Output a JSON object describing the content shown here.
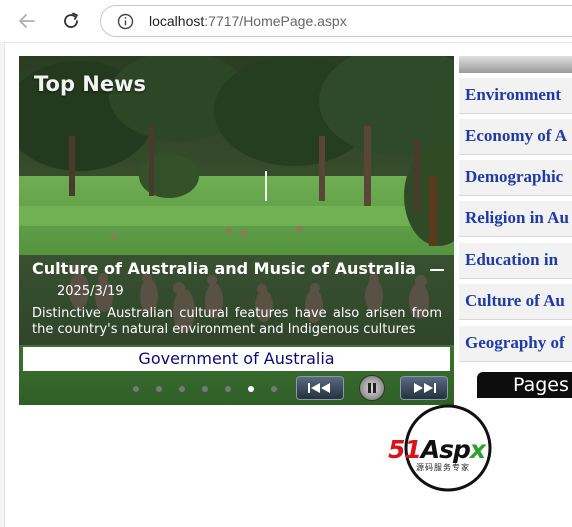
{
  "browser": {
    "url_host": "localhost",
    "url_path": ":7717/HomePage.aspx"
  },
  "slider": {
    "heading": "Top News",
    "caption_title": "Culture of Australia and Music of Australia",
    "caption_date": "2025/3/19",
    "caption_desc": "Distinctive Australian cultural features have also arisen from the country's natural environment and Indigenous cultures",
    "link_label": "Government of Australia",
    "dots": 7,
    "active_dot": 5
  },
  "right_list": {
    "items": [
      "Environment",
      "Economy of A",
      "Demographic",
      "Religion in Au",
      "Education in",
      "Culture of Au",
      "Geography of"
    ]
  },
  "pages_button": {
    "label": "Pages"
  },
  "logo": {
    "brand_51": "51",
    "brand_asp": "Asp",
    "brand_x": "x",
    "tagline": "源码服务专家"
  },
  "colors": {
    "link_blue": "#1e3aa8",
    "logo_red": "#d9131b",
    "logo_green": "#2ea02e"
  }
}
